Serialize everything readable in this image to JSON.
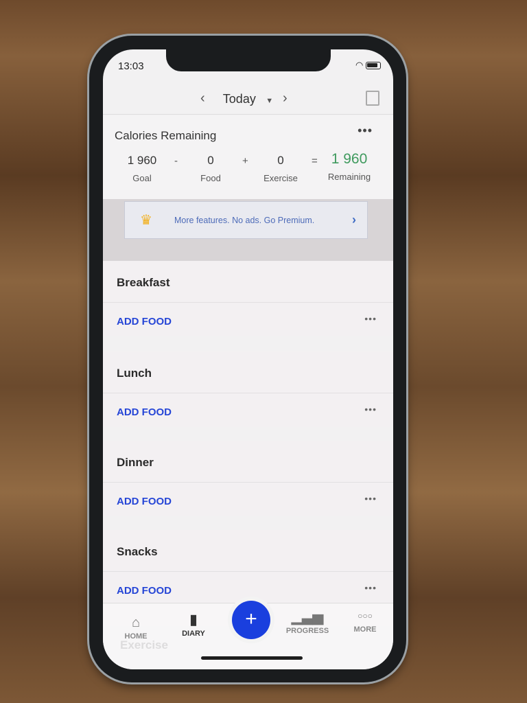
{
  "status": {
    "time": "13:03"
  },
  "header": {
    "title": "Today"
  },
  "calories": {
    "title": "Calories Remaining",
    "goal": {
      "value": "1 960",
      "label": "Goal"
    },
    "food": {
      "value": "0",
      "label": "Food"
    },
    "exercise": {
      "value": "0",
      "label": "Exercise"
    },
    "remaining": {
      "value": "1 960",
      "label": "Remaining"
    },
    "ops": [
      "-",
      "+",
      "="
    ],
    "remaining_color": "#3f9a5e"
  },
  "promo": {
    "text": "More features. No ads. Go Premium.",
    "icon": "crown-icon"
  },
  "meals": [
    {
      "name": "Breakfast",
      "action": "ADD FOOD"
    },
    {
      "name": "Lunch",
      "action": "ADD FOOD"
    },
    {
      "name": "Dinner",
      "action": "ADD FOOD"
    },
    {
      "name": "Snacks",
      "action": "ADD FOOD"
    }
  ],
  "hidden_section": "Exercise",
  "tabs": [
    {
      "label": "HOME",
      "icon": "home-icon"
    },
    {
      "label": "DIARY",
      "icon": "diary-icon",
      "active": true
    },
    {
      "label": "PROGRESS",
      "icon": "progress-icon"
    },
    {
      "label": "MORE",
      "icon": "more-icon"
    }
  ],
  "accent": "#1a3fde"
}
